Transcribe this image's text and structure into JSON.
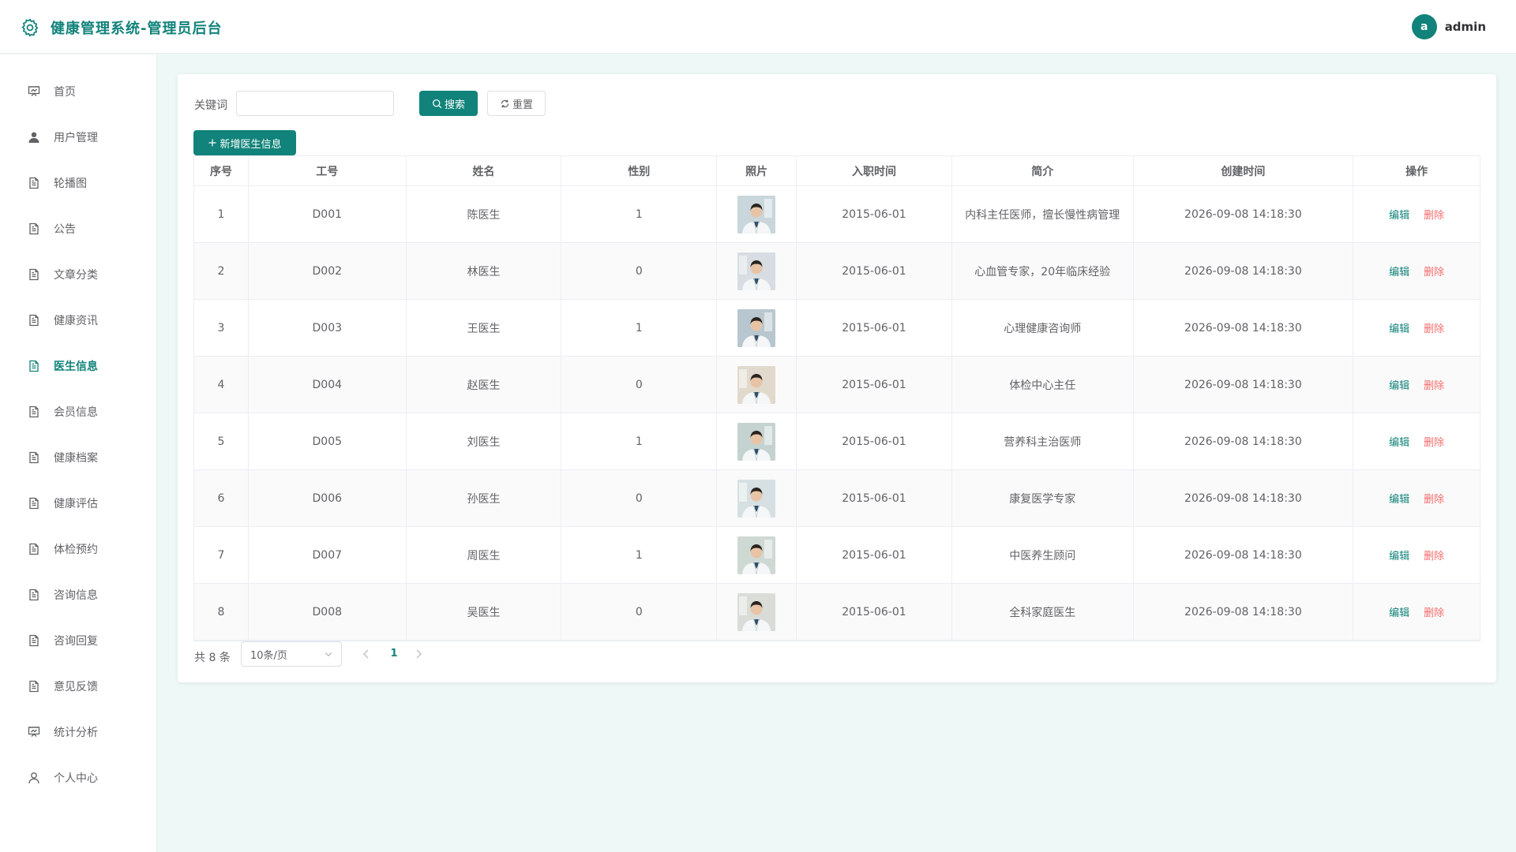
{
  "header": {
    "title": "健康管理系统-管理员后台",
    "avatar_letter": "a",
    "username": "admin"
  },
  "sidebar": {
    "active_index": 6,
    "items": [
      {
        "label": "首页",
        "icon": "presentation-icon"
      },
      {
        "label": "用户管理",
        "icon": "user-filled-icon"
      },
      {
        "label": "轮播图",
        "icon": "document-icon"
      },
      {
        "label": "公告",
        "icon": "document-icon"
      },
      {
        "label": "文章分类",
        "icon": "document-icon"
      },
      {
        "label": "健康资讯",
        "icon": "document-icon"
      },
      {
        "label": "医生信息",
        "icon": "document-icon"
      },
      {
        "label": "会员信息",
        "icon": "document-icon"
      },
      {
        "label": "健康档案",
        "icon": "document-icon"
      },
      {
        "label": "健康评估",
        "icon": "document-icon"
      },
      {
        "label": "体检预约",
        "icon": "document-icon"
      },
      {
        "label": "咨询信息",
        "icon": "document-icon"
      },
      {
        "label": "咨询回复",
        "icon": "document-icon"
      },
      {
        "label": "意见反馈",
        "icon": "document-icon"
      },
      {
        "label": "统计分析",
        "icon": "presentation-icon"
      },
      {
        "label": "个人中心",
        "icon": "user-icon"
      }
    ]
  },
  "search": {
    "label": "关键词",
    "value": "",
    "placeholder": "",
    "search_button": "搜索",
    "reset_button": "重置",
    "add_button": "新增医生信息"
  },
  "table": {
    "headers": [
      "序号",
      "工号",
      "姓名",
      "性别",
      "照片",
      "入职时间",
      "简介",
      "创建时间",
      "操作"
    ],
    "edit_label": "编辑",
    "delete_label": "删除",
    "rows": [
      {
        "index": "1",
        "code": "D001",
        "name": "陈医生",
        "gender": "1",
        "hire_date": "2015-06-01",
        "intro": "内科主任医师，擅长慢性病管理",
        "created": "2026-09-08 14:18:30"
      },
      {
        "index": "2",
        "code": "D002",
        "name": "林医生",
        "gender": "0",
        "hire_date": "2015-06-01",
        "intro": "心血管专家，20年临床经验",
        "created": "2026-09-08 14:18:30"
      },
      {
        "index": "3",
        "code": "D003",
        "name": "王医生",
        "gender": "1",
        "hire_date": "2015-06-01",
        "intro": "心理健康咨询师",
        "created": "2026-09-08 14:18:30"
      },
      {
        "index": "4",
        "code": "D004",
        "name": "赵医生",
        "gender": "0",
        "hire_date": "2015-06-01",
        "intro": "体检中心主任",
        "created": "2026-09-08 14:18:30"
      },
      {
        "index": "5",
        "code": "D005",
        "name": "刘医生",
        "gender": "1",
        "hire_date": "2015-06-01",
        "intro": "营养科主治医师",
        "created": "2026-09-08 14:18:30"
      },
      {
        "index": "6",
        "code": "D006",
        "name": "孙医生",
        "gender": "0",
        "hire_date": "2015-06-01",
        "intro": "康复医学专家",
        "created": "2026-09-08 14:18:30"
      },
      {
        "index": "7",
        "code": "D007",
        "name": "周医生",
        "gender": "1",
        "hire_date": "2015-06-01",
        "intro": "中医养生顾问",
        "created": "2026-09-08 14:18:30"
      },
      {
        "index": "8",
        "code": "D008",
        "name": "吴医生",
        "gender": "0",
        "hire_date": "2015-06-01",
        "intro": "全科家庭医生",
        "created": "2026-09-08 14:18:30"
      }
    ]
  },
  "pagination": {
    "total_text": "共 8 条",
    "page_size": "10条/页",
    "current_page": "1"
  },
  "colors": {
    "primary": "#11837a",
    "danger": "#f56c6c",
    "background": "#eef8f6"
  }
}
